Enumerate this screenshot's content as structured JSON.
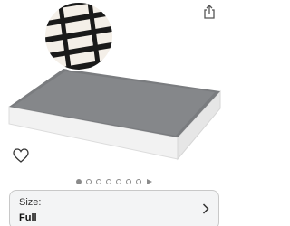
{
  "product": {
    "image_icon": "box-spring-mattress-foundation-image",
    "share_icon": "share-icon",
    "favorite_icon": "heart-outline-icon"
  },
  "carousel": {
    "dot_count": 7,
    "active_index": 0,
    "has_video": true
  },
  "size_selector": {
    "label": "Size:",
    "value": "Full",
    "icon": "chevron-right-icon"
  },
  "colors": {
    "fabric_top": "#7a7c7f",
    "side_white": "#f2f2f2",
    "accent_gray": "#8a8a8a"
  }
}
